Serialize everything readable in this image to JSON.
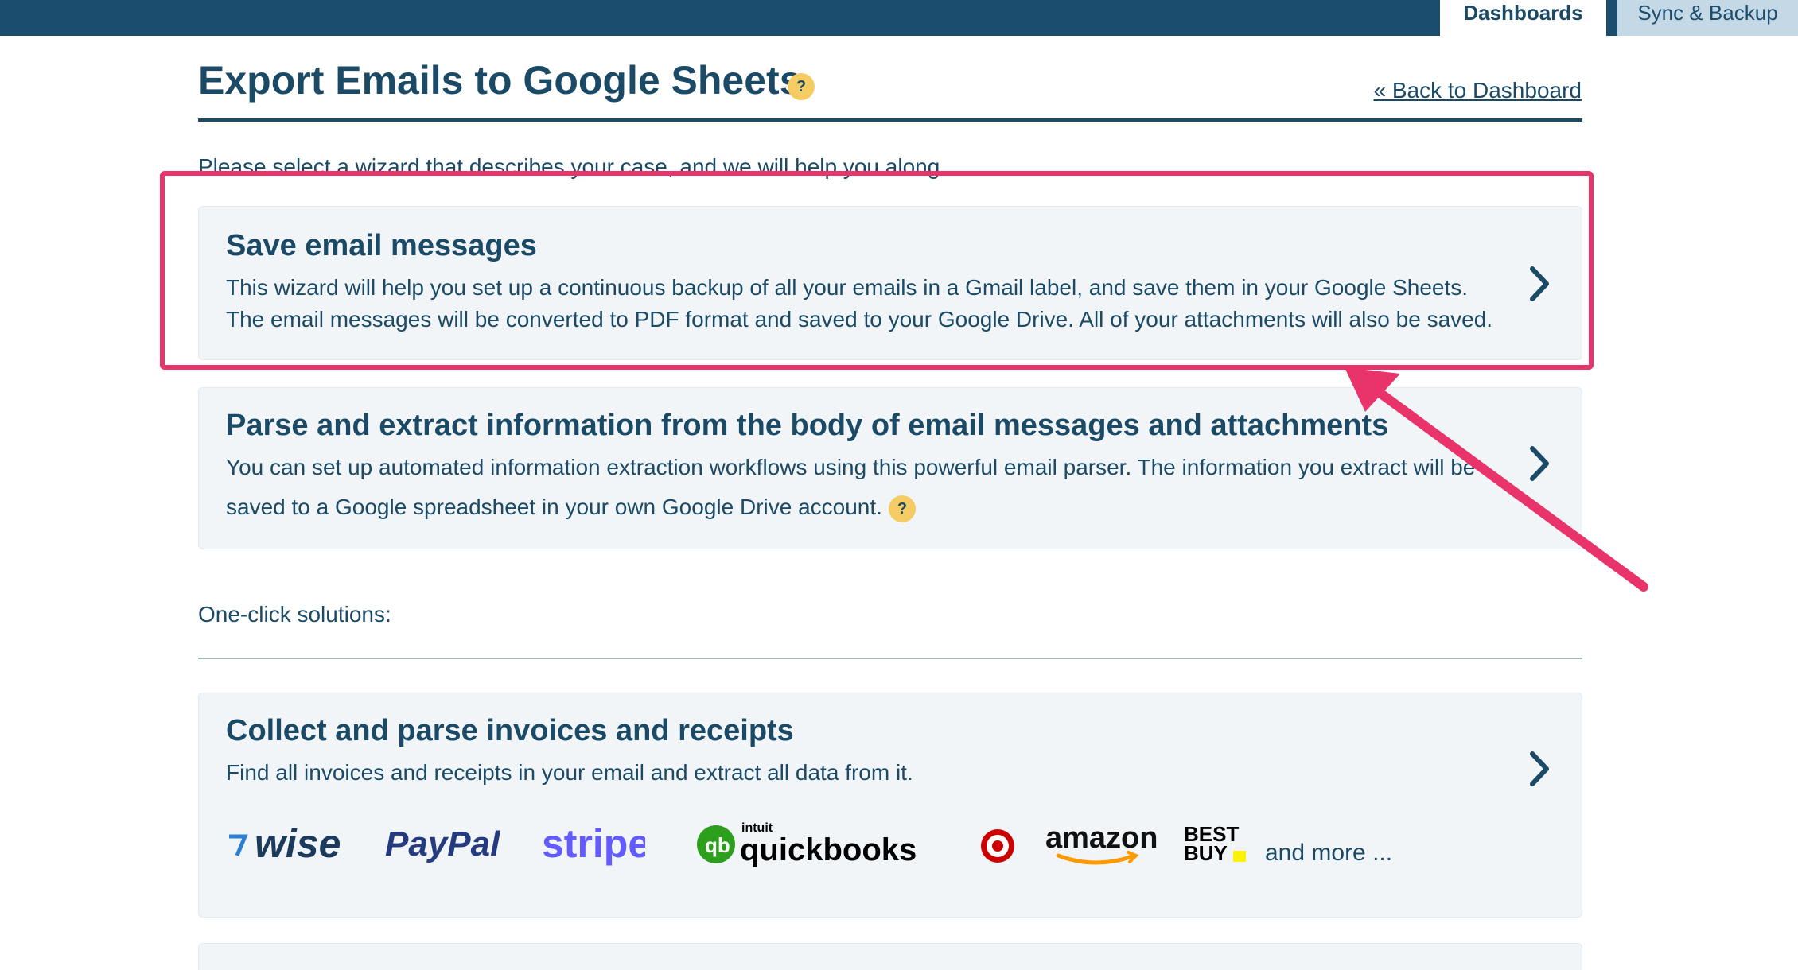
{
  "nav": {
    "tabs": [
      {
        "label": "Dashboards",
        "active": true
      },
      {
        "label": "Sync & Backup",
        "active": false
      }
    ]
  },
  "header": {
    "title": "Export Emails to Google Sheets",
    "help_icon": "?",
    "back_link": "« Back to Dashboard"
  },
  "intro": "Please select a wizard that describes your case, and we will help you along.",
  "wizards": [
    {
      "title": "Save email messages",
      "lines": [
        "This wizard will help you set up a continuous backup of all your emails in a Gmail label, and save them in your Google Sheets.",
        "The email messages will be converted to PDF format and saved to your Google Drive. All of your attachments will also be saved."
      ]
    },
    {
      "title": "Parse and extract information from the body of email messages and attachments",
      "lines": [
        "You can set up automated information extraction workflows using this powerful email parser. The information you extract will be",
        "saved to a Google spreadsheet in your own Google Drive account."
      ],
      "help_icon": "?"
    }
  ],
  "one_click": {
    "heading": "One-click solutions:",
    "solutions": [
      {
        "title": "Collect and parse invoices and receipts",
        "text": "Find all invoices and receipts in your email and extract all data from it.",
        "logos": [
          "wise",
          "PayPal",
          "stripe",
          "intuit",
          "quickbooks",
          "amazon",
          "BEST",
          "BUY"
        ],
        "more_label": "and more ..."
      }
    ]
  },
  "colors": {
    "nav_bg": "#1b4e6e",
    "text": "#1b4a66",
    "card_bg": "#f2f5f8",
    "highlight": "#e8336b",
    "help_badge": "#f5cc63"
  },
  "icons": [
    "help-icon",
    "chevron-right-icon",
    "annotation-arrow"
  ]
}
